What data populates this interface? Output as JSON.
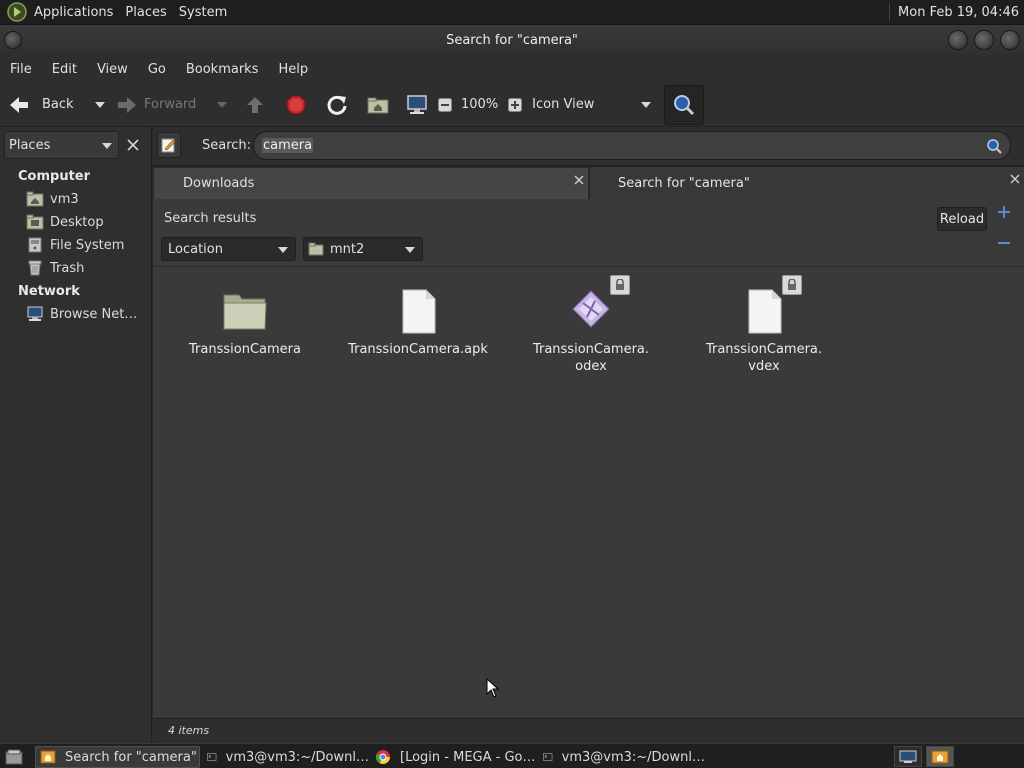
{
  "top_panel": {
    "menus": [
      "Applications",
      "Places",
      "System"
    ],
    "clock": "Mon Feb 19, 04:46"
  },
  "window": {
    "title": "Search for \"camera\""
  },
  "menubar": [
    "File",
    "Edit",
    "View",
    "Go",
    "Bookmarks",
    "Help"
  ],
  "toolbar": {
    "back_label": "Back",
    "forward_label": "Forward",
    "zoom_level": "100%",
    "view_mode": "Icon View"
  },
  "sidebar": {
    "selector_label": "Places",
    "sections": [
      {
        "heading": "Computer",
        "items": [
          {
            "label": "vm3",
            "icon": "home-folder-icon"
          },
          {
            "label": "Desktop",
            "icon": "desktop-folder-icon"
          },
          {
            "label": "File System",
            "icon": "drive-icon"
          },
          {
            "label": "Trash",
            "icon": "trash-icon"
          }
        ]
      },
      {
        "heading": "Network",
        "items": [
          {
            "label": "Browse Net…",
            "icon": "network-icon"
          }
        ]
      }
    ]
  },
  "location": {
    "search_label": "Search:",
    "search_value": "camera"
  },
  "tabs": [
    {
      "label": "Downloads"
    },
    {
      "label": "Search for \"camera\""
    }
  ],
  "search_panel": {
    "title": "Search results",
    "reload_label": "Reload",
    "criterion": "Location",
    "location_value": "mnt2"
  },
  "files": [
    {
      "name": "TranssionCamera",
      "icon": "folder-icon",
      "locked": false
    },
    {
      "name": "TranssionCamera.apk",
      "icon": "file-icon",
      "locked": false
    },
    {
      "name": "TranssionCamera.\nodex",
      "icon": "binary-file-icon",
      "locked": true
    },
    {
      "name": "TranssionCamera.\nvdex",
      "icon": "file-icon",
      "locked": true
    }
  ],
  "status": {
    "text": "4 items"
  },
  "taskbar": {
    "tasks": [
      {
        "label": "Search for \"camera\"",
        "icon": "file-manager-icon",
        "active": true
      },
      {
        "label": "vm3@vm3:~/Downl…",
        "icon": "terminal-icon",
        "active": false
      },
      {
        "label": "[Login - MEGA - Go…",
        "icon": "chrome-icon",
        "active": false
      },
      {
        "label": "vm3@vm3:~/Downl…",
        "icon": "terminal-icon",
        "active": false
      }
    ]
  },
  "colors": {
    "accent": "#5b8dd6",
    "stop": "#c02a2a"
  }
}
